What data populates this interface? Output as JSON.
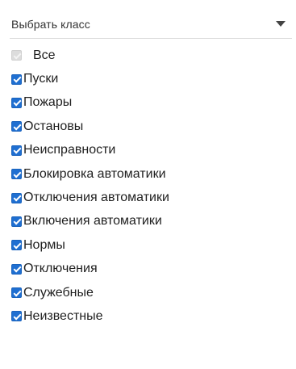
{
  "dropdown": {
    "label": "Выбрать класс",
    "icon": "chevron-down-icon"
  },
  "items": [
    {
      "label": "Все",
      "checked": false
    },
    {
      "label": "Пуски",
      "checked": true
    },
    {
      "label": "Пожары",
      "checked": true
    },
    {
      "label": "Остановы",
      "checked": true
    },
    {
      "label": "Неисправности",
      "checked": true
    },
    {
      "label": "Блокировка автоматики",
      "checked": true
    },
    {
      "label": "Отключения автоматики",
      "checked": true
    },
    {
      "label": "Включения автоматики",
      "checked": true
    },
    {
      "label": "Нормы",
      "checked": true
    },
    {
      "label": "Отключения",
      "checked": true
    },
    {
      "label": "Служебные",
      "checked": true
    },
    {
      "label": "Неизвестные",
      "checked": true
    }
  ],
  "colors": {
    "checkbox_checked": "#1f6fd1",
    "checkbox_unchecked": "#dcdcdc"
  }
}
